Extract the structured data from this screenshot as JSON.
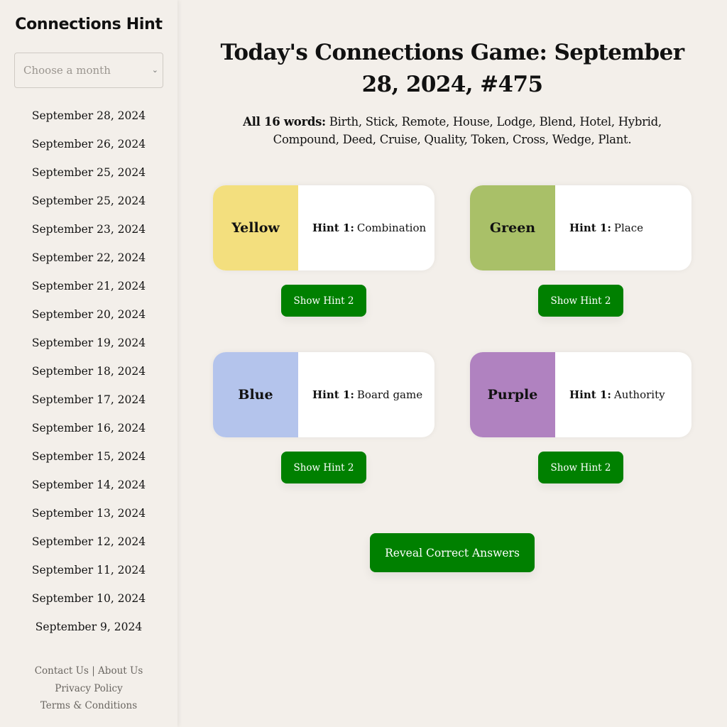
{
  "sidebar": {
    "site_title": "Connections Hint",
    "month_select": {
      "placeholder": "Choose a month",
      "icon": "chevron-down-icon"
    },
    "dates": [
      "September 28, 2024",
      "September 26, 2024",
      "September 25, 2024",
      "September 25, 2024",
      "September 23, 2024",
      "September 22, 2024",
      "September 21, 2024",
      "September 20, 2024",
      "September 19, 2024",
      "September 18, 2024",
      "September 17, 2024",
      "September 16, 2024",
      "September 15, 2024",
      "September 14, 2024",
      "September 13, 2024",
      "September 12, 2024",
      "September 11, 2024",
      "September 10, 2024",
      "September 9, 2024"
    ],
    "footer": {
      "contact": "Contact Us",
      "separator": " | ",
      "about": "About Us",
      "privacy": "Privacy Policy",
      "terms": "Terms & Conditions"
    }
  },
  "main": {
    "title": "Today's Connections Game: September 28, 2024, #475",
    "all_words_label": "All 16 words:",
    "all_words": " Birth, Stick, Remote, House, Lodge, Blend, Hotel, Hybrid, Compound, Deed, Cruise, Quality, Token, Cross, Wedge, Plant.",
    "hint_label": "Hint 1:",
    "groups": [
      {
        "color_name": "Yellow",
        "color": "#f3df7e",
        "hint1": "Combination",
        "button": "Show Hint 2"
      },
      {
        "color_name": "Green",
        "color": "#a9c068",
        "hint1": "Place",
        "button": "Show Hint 2"
      },
      {
        "color_name": "Blue",
        "color": "#b4c4ec",
        "hint1": "Board game",
        "button": "Show Hint 2"
      },
      {
        "color_name": "Purple",
        "color": "#b082c0",
        "hint1": "Authority",
        "button": "Show Hint 2"
      }
    ],
    "reveal_button": "Reveal Correct Answers",
    "button_color": "#008000"
  }
}
